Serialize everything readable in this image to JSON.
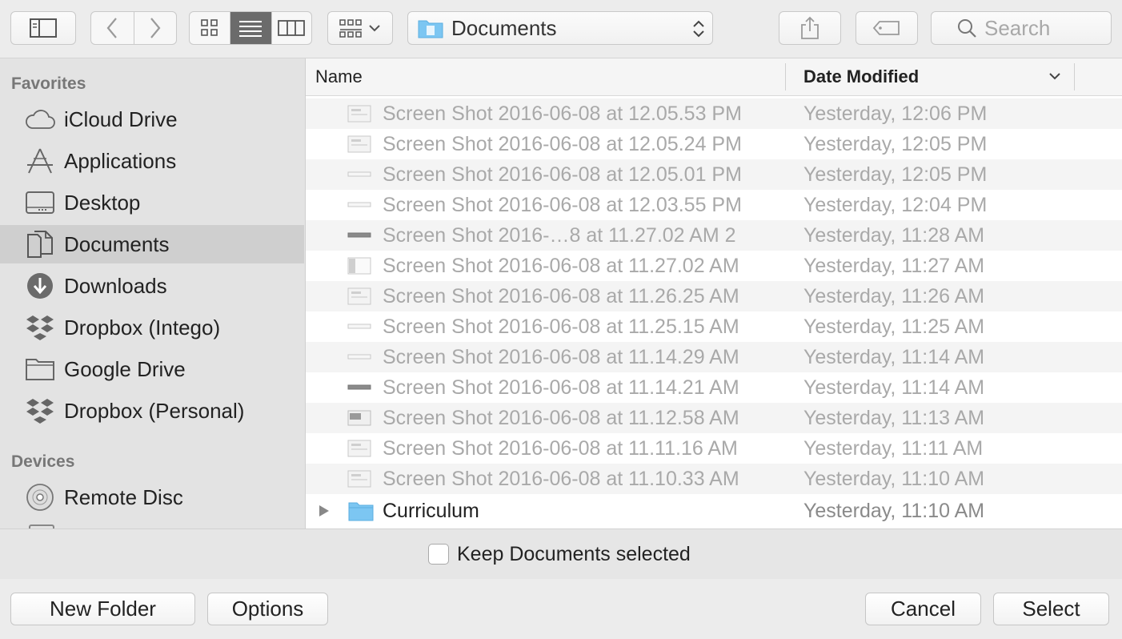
{
  "toolbar": {
    "path_label": "Documents",
    "search_placeholder": "Search"
  },
  "sidebar": {
    "favorites_header": "Favorites",
    "favorites": [
      {
        "label": "iCloud Drive",
        "icon": "cloud-icon"
      },
      {
        "label": "Applications",
        "icon": "applications-icon"
      },
      {
        "label": "Desktop",
        "icon": "desktop-icon"
      },
      {
        "label": "Documents",
        "icon": "documents-icon",
        "selected": true
      },
      {
        "label": "Downloads",
        "icon": "downloads-icon"
      },
      {
        "label": "Dropbox (Intego)",
        "icon": "dropbox-icon"
      },
      {
        "label": "Google Drive",
        "icon": "folder-icon"
      },
      {
        "label": "Dropbox (Personal)",
        "icon": "dropbox-icon"
      }
    ],
    "devices_header": "Devices",
    "devices": [
      {
        "label": "Remote Disc",
        "icon": "disc-icon"
      }
    ]
  },
  "list": {
    "columns": {
      "name": "Name",
      "date": "Date Modified"
    },
    "rows": [
      {
        "name": "Screen Shot 2016-06-08 at 12.05.53 PM",
        "date": "Yesterday, 12:06 PM"
      },
      {
        "name": "Screen Shot 2016-06-08 at 12.05.24 PM",
        "date": "Yesterday, 12:05 PM"
      },
      {
        "name": "Screen Shot 2016-06-08 at 12.05.01 PM",
        "date": "Yesterday, 12:05 PM"
      },
      {
        "name": "Screen Shot 2016-06-08 at 12.03.55 PM",
        "date": "Yesterday, 12:04 PM"
      },
      {
        "name": "Screen Shot 2016-…8 at 11.27.02 AM 2",
        "date": "Yesterday, 11:28 AM"
      },
      {
        "name": "Screen Shot 2016-06-08 at 11.27.02 AM",
        "date": "Yesterday, 11:27 AM"
      },
      {
        "name": "Screen Shot 2016-06-08 at 11.26.25 AM",
        "date": "Yesterday, 11:26 AM"
      },
      {
        "name": "Screen Shot 2016-06-08 at 11.25.15 AM",
        "date": "Yesterday, 11:25 AM"
      },
      {
        "name": "Screen Shot 2016-06-08 at 11.14.29 AM",
        "date": "Yesterday, 11:14 AM"
      },
      {
        "name": "Screen Shot 2016-06-08 at 11.14.21 AM",
        "date": "Yesterday, 11:14 AM"
      },
      {
        "name": "Screen Shot 2016-06-08 at 11.12.58 AM",
        "date": "Yesterday, 11:13 AM"
      },
      {
        "name": "Screen Shot 2016-06-08 at 11.11.16 AM",
        "date": "Yesterday, 11:11 AM"
      },
      {
        "name": "Screen Shot 2016-06-08 at 11.10.33 AM",
        "date": "Yesterday, 11:10 AM"
      }
    ],
    "folder": {
      "name": "Curriculum",
      "date": "Yesterday, 11:10 AM"
    }
  },
  "keep_selected_label": "Keep Documents selected",
  "buttons": {
    "new_folder": "New Folder",
    "options": "Options",
    "cancel": "Cancel",
    "select": "Select"
  },
  "colors": {
    "folder_blue": "#7cc6f2",
    "selected_sidebar": "#cfcfcf"
  }
}
